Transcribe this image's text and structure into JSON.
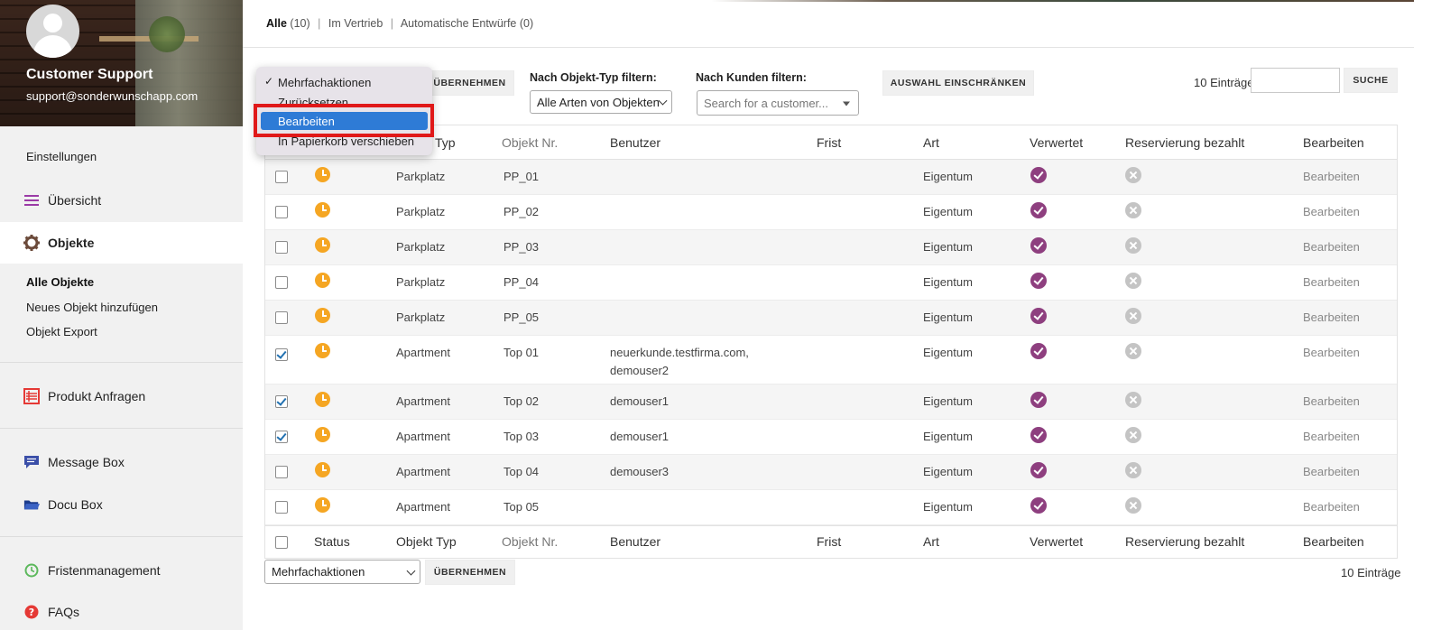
{
  "sidebar": {
    "profile": {
      "name": "Customer Support",
      "email": "support@sonderwunschapp.com"
    },
    "items": [
      {
        "label": "Einstellungen"
      },
      {
        "label": "Übersicht",
        "icon": "menu-lines-icon"
      },
      {
        "label": "Objekte",
        "icon": "gear-icon"
      },
      {
        "label": "Alle Objekte"
      },
      {
        "label": "Neues Objekt hinzufügen"
      },
      {
        "label": "Objekt Export"
      },
      {
        "label": "Produkt Anfragen",
        "icon": "list-icon"
      },
      {
        "label": "Message Box",
        "icon": "chat-icon"
      },
      {
        "label": "Docu Box",
        "icon": "folder-icon"
      },
      {
        "label": "Fristenmanagement",
        "icon": "clock-icon"
      },
      {
        "label": "FAQs",
        "icon": "question-icon"
      }
    ]
  },
  "views": {
    "all_label": "Alle",
    "all_count": "(10)",
    "sep": "|",
    "sale_label": "Im Vertrieb",
    "drafts_label": "Automatische Entwürfe",
    "drafts_count": "(0)"
  },
  "filters": {
    "apply_label": "ÜBERNEHMEN",
    "type_label": "Nach Objekt-Typ filtern:",
    "type_value": "Alle Arten von Objekten",
    "customer_label": "Nach Kunden filtern:",
    "customer_placeholder": "Search for a customer...",
    "restrict_label": "AUSWAHL EINSCHRÄNKEN",
    "entries": "10 Einträge",
    "search_label": "SUCHE"
  },
  "bulk_menu": {
    "options": [
      "Mehrfachaktionen",
      "Zurücksetzen",
      "Bearbeiten",
      "In Papierkorb verschieben"
    ],
    "checked": "✓",
    "highlighted": "Bearbeiten"
  },
  "table": {
    "columns": [
      "Status",
      "Objekt Typ",
      "Objekt Nr.",
      "Benutzer",
      "Frist",
      "Art",
      "Verwertet",
      "Reservierung bezahlt",
      "Bearbeiten"
    ],
    "header_typ_partial": "Typ",
    "rows": [
      {
        "checked": false,
        "typ": "Parkplatz",
        "nr": "PP_01",
        "benutzer": "",
        "art": "Eigentum",
        "verwertet": true,
        "bezahlt": false,
        "edit": "Bearbeiten"
      },
      {
        "checked": false,
        "typ": "Parkplatz",
        "nr": "PP_02",
        "benutzer": "",
        "art": "Eigentum",
        "verwertet": true,
        "bezahlt": false,
        "edit": "Bearbeiten"
      },
      {
        "checked": false,
        "typ": "Parkplatz",
        "nr": "PP_03",
        "benutzer": "",
        "art": "Eigentum",
        "verwertet": true,
        "bezahlt": false,
        "edit": "Bearbeiten"
      },
      {
        "checked": false,
        "typ": "Parkplatz",
        "nr": "PP_04",
        "benutzer": "",
        "art": "Eigentum",
        "verwertet": true,
        "bezahlt": false,
        "edit": "Bearbeiten"
      },
      {
        "checked": false,
        "typ": "Parkplatz",
        "nr": "PP_05",
        "benutzer": "",
        "art": "Eigentum",
        "verwertet": true,
        "bezahlt": false,
        "edit": "Bearbeiten"
      },
      {
        "checked": true,
        "typ": "Apartment",
        "nr": "Top 01",
        "benutzer": "neuerkunde.testfirma.com,",
        "benutzer2": "demouser2",
        "art": "Eigentum",
        "verwertet": true,
        "bezahlt": false,
        "edit": "Bearbeiten"
      },
      {
        "checked": true,
        "typ": "Apartment",
        "nr": "Top 02",
        "benutzer": "demouser1",
        "art": "Eigentum",
        "verwertet": true,
        "bezahlt": false,
        "edit": "Bearbeiten"
      },
      {
        "checked": true,
        "typ": "Apartment",
        "nr": "Top 03",
        "benutzer": "demouser1",
        "art": "Eigentum",
        "verwertet": true,
        "bezahlt": false,
        "edit": "Bearbeiten"
      },
      {
        "checked": false,
        "typ": "Apartment",
        "nr": "Top 04",
        "benutzer": "demouser3",
        "art": "Eigentum",
        "verwertet": true,
        "bezahlt": false,
        "edit": "Bearbeiten"
      },
      {
        "checked": false,
        "typ": "Apartment",
        "nr": "Top 05",
        "benutzer": "",
        "art": "Eigentum",
        "verwertet": true,
        "bezahlt": false,
        "edit": "Bearbeiten"
      }
    ]
  },
  "bottom": {
    "bulk_value": "Mehrfachaktionen",
    "apply_label": "ÜBERNEHMEN",
    "entries": "10 Einträge"
  },
  "colors": {
    "accent_purple": "#8e3f7f",
    "status_orange": "#f5a623",
    "highlight_blue": "#2e7bd6",
    "annotation_red": "#e01919"
  }
}
